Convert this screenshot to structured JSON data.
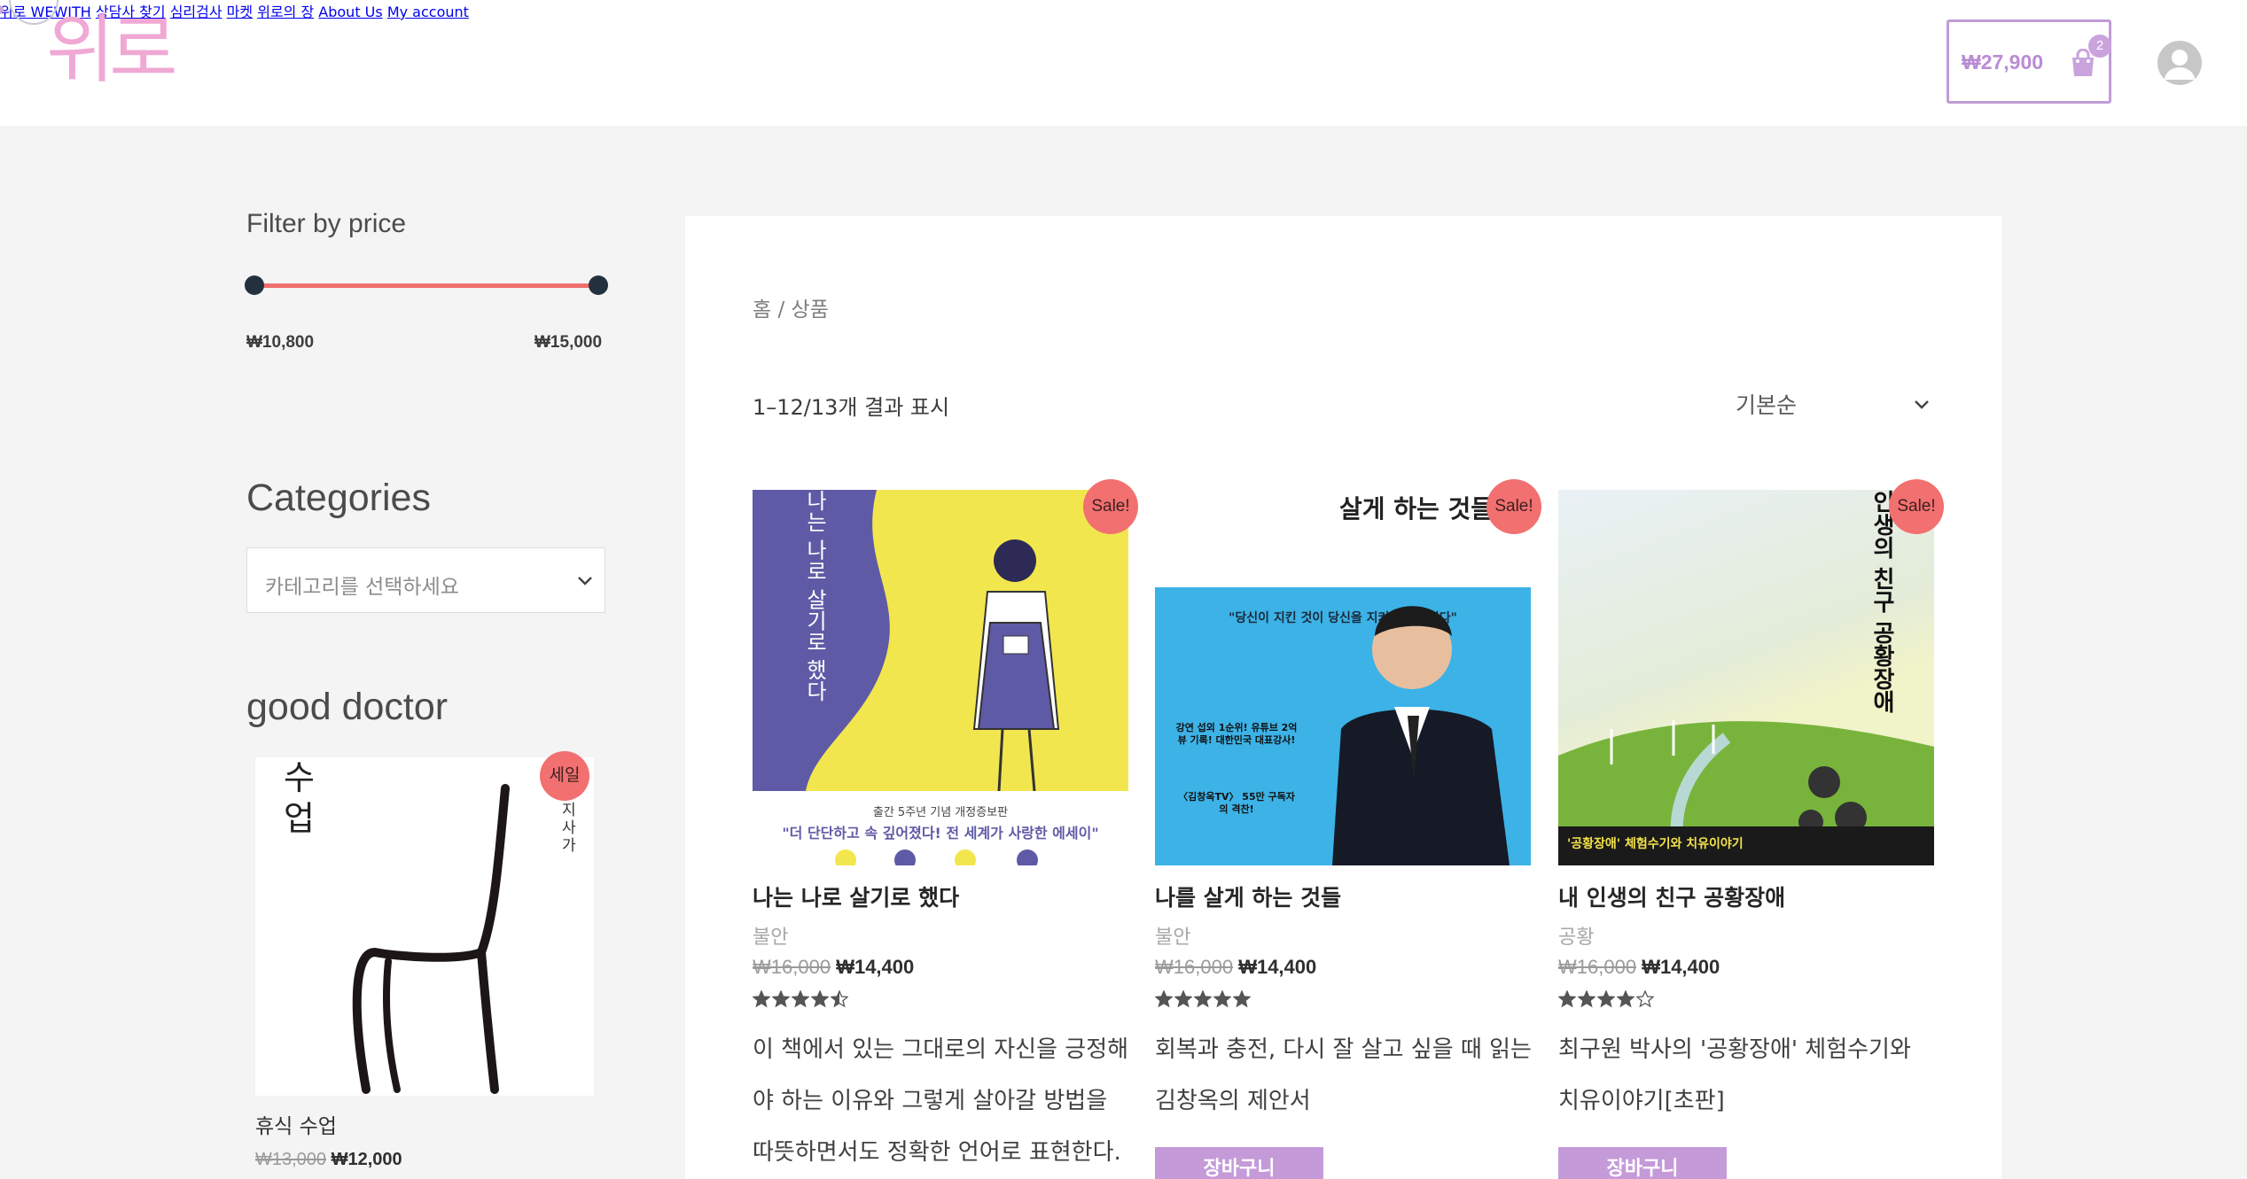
{
  "brand": {
    "logo_text": "위로"
  },
  "nav": {
    "items": [
      "위로 WEWITH",
      "상담사 찾기",
      "심리검사",
      "마켓",
      "위로의 장",
      "About Us",
      "My account"
    ]
  },
  "cart": {
    "total": "₩27,900",
    "count": "2"
  },
  "colors": {
    "accent": "#c59ad9",
    "sale_badge": "#f27070",
    "slider": "#f06d6d",
    "handle": "#23313f"
  },
  "filter": {
    "title": "Filter by price",
    "min_label": "₩10,800",
    "max_label": "₩15,000"
  },
  "categories": {
    "title": "Categories",
    "placeholder": "카테고리를 선택하세요"
  },
  "good_doctor": {
    "title": "good doctor",
    "book": {
      "badge": "세일",
      "cover_text": "수\n업",
      "cover_side": "지\n사\n가",
      "name": "휴식 수업",
      "old_price": "₩13,000",
      "price": "₩12,000"
    }
  },
  "shop": {
    "breadcrumb": "홈 / 상품",
    "results": "1–12/13개 결과 표시",
    "orderby": "기본순",
    "products": [
      {
        "badge": "Sale!",
        "title": "나는 나로 살기로 했다",
        "category": "불안",
        "old_price": "₩16,000",
        "price": "₩14,400",
        "rating": 4.5,
        "description": "이 책에서 있는 그대로의 자신을 긍정해야 하는 이유와 그렇게 살아갈 방법을 따뜻하면서도 정확한 언어로 표현한다.",
        "cover": {
          "vertical_title": "나는 나로 살기로 했다",
          "band_text": "출간 5주년 기념 개정증보판",
          "quote": "\"더 단단하고 속 깊어졌다! 전 세계가 사랑한 에세이\""
        }
      },
      {
        "badge": "Sale!",
        "title": "나를 살게 하는 것들",
        "category": "불안",
        "old_price": "₩16,000",
        "price": "₩14,400",
        "rating": 5,
        "description": "회복과 충전, 다시 잘 살고 싶을 때 읽는 김창옥의 제안서",
        "button": "장바구니",
        "cover": {
          "top_text": "살게 하는 것들",
          "quote": "\"당신이 지킨 것이 당신을 지켜줄 것입니다\"",
          "award1": "강연 섭외 1순위! 유튜브 2억 뷰 기록! 대한민국 대표강사!",
          "award2": "〈김창옥TV〉 55만 구독자의 격찬!"
        }
      },
      {
        "badge": "Sale!",
        "title": "내 인생의 친구 공황장애",
        "category": "공황",
        "old_price": "₩16,000",
        "price": "₩14,400",
        "rating": 4,
        "description": "최구원 박사의 '공황장애' 체험수기와 치유이야기[초판]",
        "button": "장바구니",
        "cover": {
          "vertical_title": "인생의 친구 공황장애",
          "band_text": "'공황장애' 체험수기와 치유이야기"
        }
      }
    ]
  }
}
